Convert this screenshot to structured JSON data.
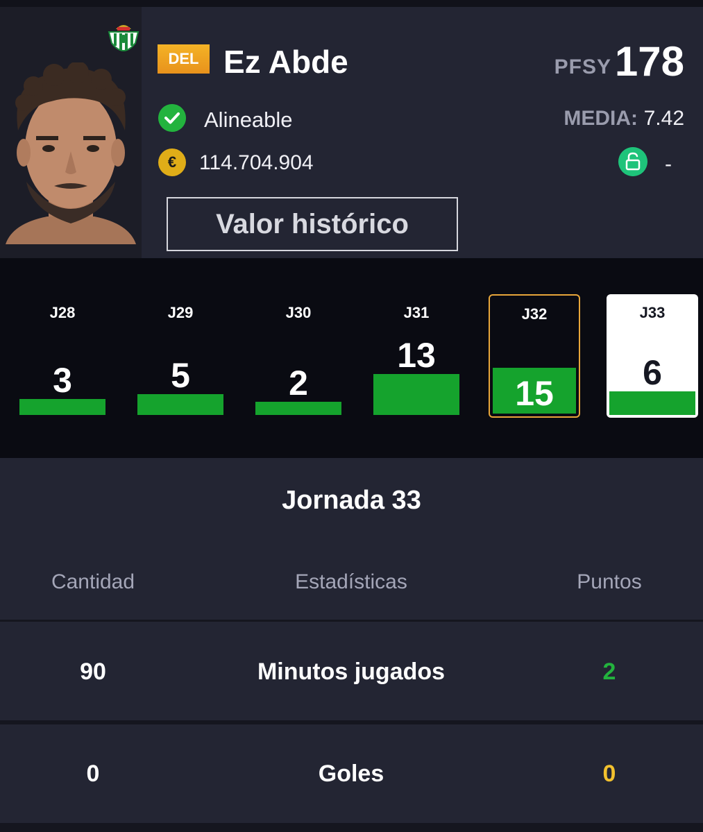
{
  "player": {
    "position": "DEL",
    "name": "Ez Abde",
    "pfsy_label": "PFSY",
    "pfsy_value": "178",
    "status": "Alineable",
    "media_label": "MEDIA:",
    "media_value": "7.42",
    "market_value": "114.704.904",
    "coin_symbol": "€",
    "clause": "-",
    "history_button": "Valor histórico"
  },
  "colors": {
    "accent_bar": "#15a32d",
    "position_badge": "#f0a424",
    "current_round_border": "#e8a63a",
    "points_positive": "#23b33e",
    "points_zero": "#f2c12e"
  },
  "rounds": [
    {
      "label": "J28",
      "points": "3",
      "level": 3,
      "state": "normal"
    },
    {
      "label": "J29",
      "points": "5",
      "level": 5,
      "state": "normal"
    },
    {
      "label": "J30",
      "points": "2",
      "level": 2,
      "state": "normal"
    },
    {
      "label": "J31",
      "points": "13",
      "level": 13,
      "state": "normal"
    },
    {
      "label": "J32",
      "points": "15",
      "level": 15,
      "state": "current"
    },
    {
      "label": "J33",
      "points": "6",
      "level": 6,
      "state": "selected"
    }
  ],
  "stats": {
    "title": "Jornada 33",
    "headers": {
      "quantity": "Cantidad",
      "stat": "Estadísticas",
      "points": "Puntos"
    },
    "rows": [
      {
        "quantity": "90",
        "stat": "Minutos jugados",
        "points": "2",
        "points_color": "#23b33e"
      },
      {
        "quantity": "0",
        "stat": "Goles",
        "points": "0",
        "points_color": "#f2c12e"
      }
    ]
  }
}
